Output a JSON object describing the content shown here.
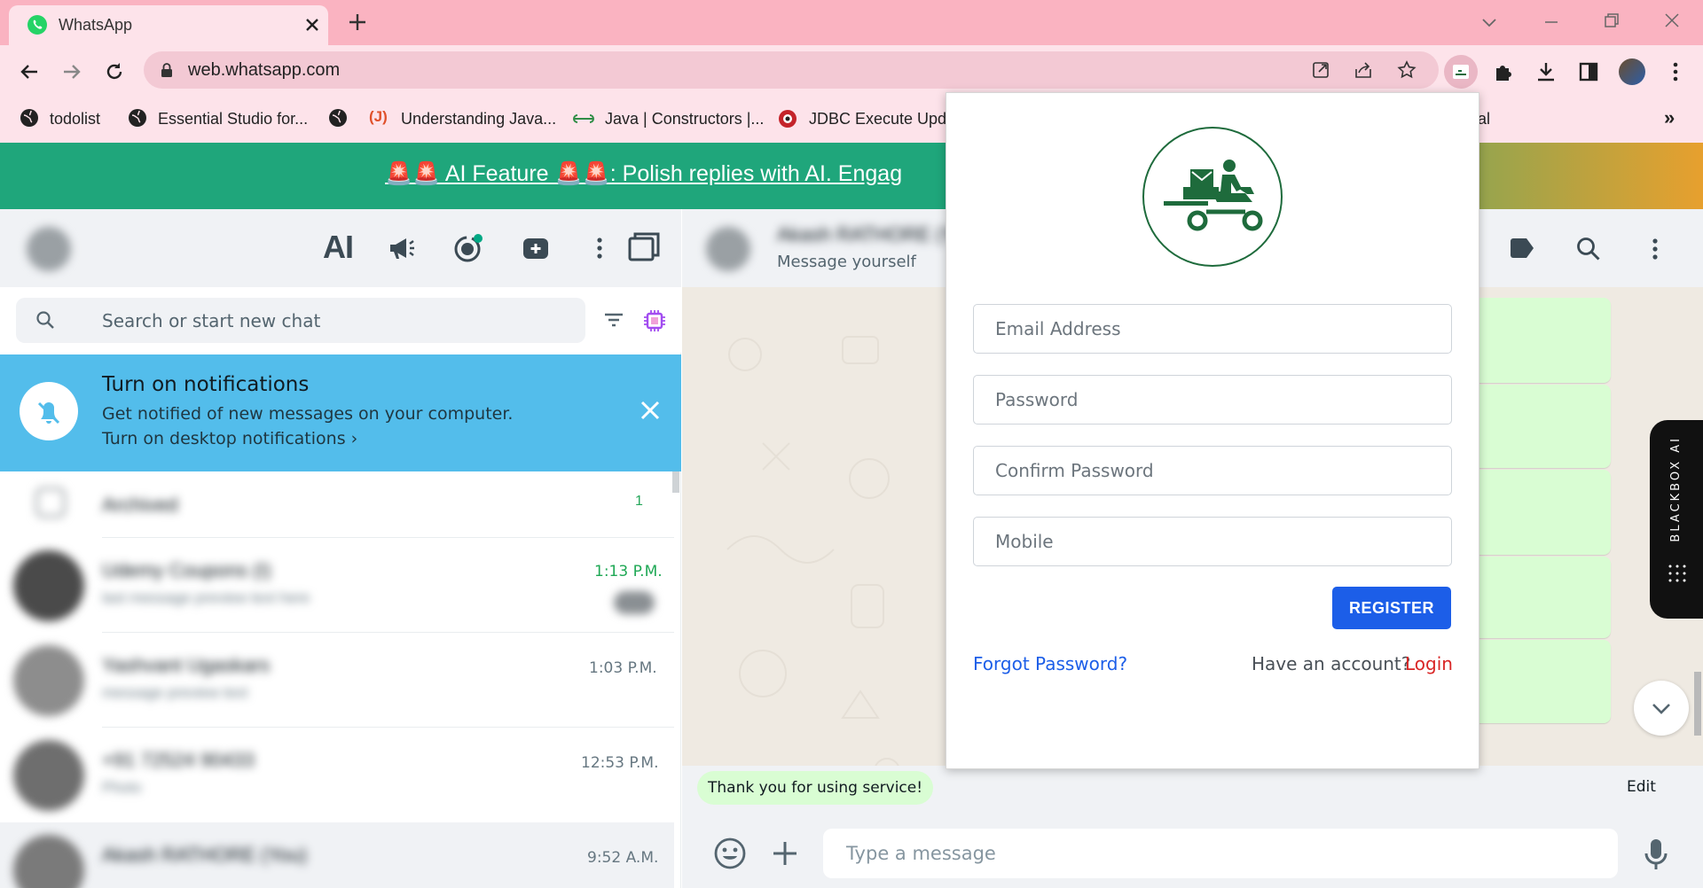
{
  "browser": {
    "tab_title": "WhatsApp",
    "url": "web.whatsapp.com",
    "bookmarks": [
      {
        "label": "todolist"
      },
      {
        "label": "Essential Studio for..."
      },
      {
        "label": ""
      },
      {
        "label": "Understanding Java..."
      },
      {
        "label": "Java | Constructors |..."
      },
      {
        "label": "JDBC Execute Upda"
      }
    ],
    "bookmark_overflow_tail": "al"
  },
  "promo": {
    "text": "🚨🚨 AI Feature 🚨🚨: Polish replies with AI. Engag"
  },
  "sidebar": {
    "ai_label": "AI",
    "search_placeholder": "Search or start new chat",
    "notification": {
      "title": "Turn on notifications",
      "body": "Get notified of new messages on your computer.",
      "link": "Turn on desktop notifications ›"
    },
    "archived": {
      "label": "Archived",
      "count": "1"
    },
    "chats": [
      {
        "name": "Udemy Coupons (I)",
        "time": "1:13 P.M.",
        "preview": "last message preview text here",
        "unread": true
      },
      {
        "name": "Yashvant Ugaskars",
        "time": "1:03 P.M.",
        "preview": "message preview text",
        "unread": false
      },
      {
        "name": "+91 72524 90433",
        "time": "12:53 P.M.",
        "preview": "Photo",
        "unread": false
      },
      {
        "name": "Akash RATHORE (You)",
        "time": "9:52 A.M.",
        "preview": "",
        "unread": false
      }
    ]
  },
  "chat": {
    "contact_name": "Akash RATHORE (You)",
    "subtitle": "Message yourself",
    "quick_reply": "Thank you for using service!",
    "edit_label": "Edit",
    "input_placeholder": "Type a message"
  },
  "popup": {
    "fields": {
      "email": "Email Address",
      "password": "Password",
      "confirm": "Confirm Password",
      "mobile": "Mobile"
    },
    "register_label": "REGISTER",
    "forgot_label": "Forgot Password?",
    "have_account": "Have an account?",
    "login_label": "Login"
  },
  "blackbox": {
    "label": "BLACKBOX AI"
  },
  "colors": {
    "tab_strip": "#fab3c1",
    "toolbar": "#fde3ea",
    "whatsapp_green": "#1fa67b",
    "notification_blue": "#53bdeb",
    "register_blue": "#1c5ee8",
    "login_red": "#d92626",
    "logo_green": "#1e6b3c"
  }
}
